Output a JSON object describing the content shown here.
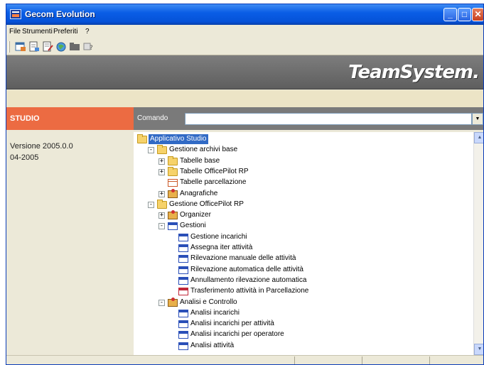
{
  "window": {
    "title": "Gecom Evolution"
  },
  "menu": [
    "File",
    "Strumenti",
    "Preferiti",
    "?"
  ],
  "toolbar": {
    "icons": [
      "new-document-icon",
      "open-document-icon",
      "edit-document-icon",
      "globe-icon",
      "folder-icon",
      "help-icon"
    ]
  },
  "banner": {
    "brand": "TeamSystem."
  },
  "studio": {
    "header": "STUDIO",
    "version": "Versione 2005.0.0",
    "date": "04-2005"
  },
  "command": {
    "label": "Comando",
    "value": ""
  },
  "tree": [
    {
      "label": "Applicativo Studio",
      "level": 0,
      "icon": "folder",
      "expander": "",
      "selected": true
    },
    {
      "label": "Gestione archivi base",
      "level": 1,
      "icon": "folder",
      "expander": "-"
    },
    {
      "label": "Tabelle base",
      "level": 2,
      "icon": "folder",
      "expander": "+"
    },
    {
      "label": "Tabelle OfficePilot RP",
      "level": 2,
      "icon": "folder",
      "expander": "+"
    },
    {
      "label": "Tabelle parcellazione",
      "level": 2,
      "icon": "table",
      "expander": ""
    },
    {
      "label": "Anagrafiche",
      "level": 2,
      "icon": "person",
      "expander": "+"
    },
    {
      "label": "Gestione OfficePilot RP",
      "level": 1,
      "icon": "folder",
      "expander": "-"
    },
    {
      "label": "Organizer",
      "level": 2,
      "icon": "person",
      "expander": "+"
    },
    {
      "label": "Gestioni",
      "level": 2,
      "icon": "window",
      "expander": "-"
    },
    {
      "label": "Gestione incarichi",
      "level": 3,
      "icon": "window",
      "expander": ""
    },
    {
      "label": "Assegna iter attività",
      "level": 3,
      "icon": "window",
      "expander": ""
    },
    {
      "label": "Rilevazione manuale delle attività",
      "level": 3,
      "icon": "window",
      "expander": ""
    },
    {
      "label": "Rilevazione automatica delle attività",
      "level": 3,
      "icon": "window",
      "expander": ""
    },
    {
      "label": "Annullamento rilevazione automatica",
      "level": 3,
      "icon": "window",
      "expander": ""
    },
    {
      "label": "Trasferimento attività in Parcellazione",
      "level": 3,
      "icon": "red-window",
      "expander": ""
    },
    {
      "label": "Analisi e Controllo",
      "level": 2,
      "icon": "person",
      "expander": "-"
    },
    {
      "label": "Analisi incarichi",
      "level": 3,
      "icon": "window",
      "expander": ""
    },
    {
      "label": "Analisi incarichi per attività",
      "level": 3,
      "icon": "window",
      "expander": ""
    },
    {
      "label": "Analisi incarichi per operatore",
      "level": 3,
      "icon": "window",
      "expander": ""
    },
    {
      "label": "Analisi attività",
      "level": 3,
      "icon": "window",
      "expander": ""
    }
  ],
  "colors": {
    "accent": "#ec6b42",
    "selection": "#316ac5",
    "banner": "#6e6e6e"
  }
}
